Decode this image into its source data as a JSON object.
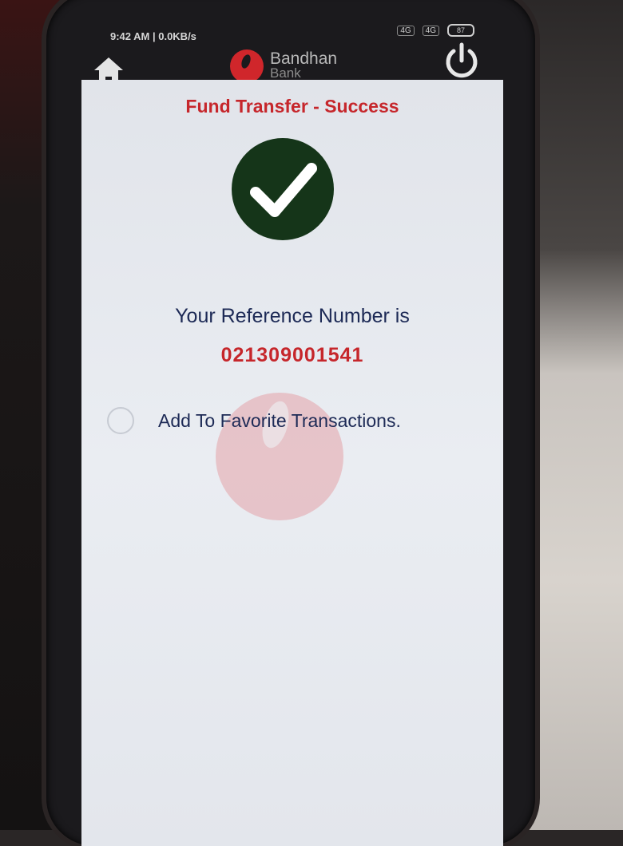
{
  "status_bar": {
    "time": "9:42 AM | 0.0KB/s",
    "sim1_label": "4G",
    "sim2_label": "4G",
    "battery": "87"
  },
  "app_bar": {
    "logo_name": "Bandhan",
    "logo_sub": "Bank",
    "home_icon": "home-icon",
    "power_icon": "power-icon"
  },
  "content": {
    "title": "Fund Transfer - Success",
    "reference_label": "Your Reference Number is",
    "reference_number": "021309001541",
    "favorite_label": "Add To Favorite Transactions."
  },
  "colors": {
    "accent_red": "#c6262b",
    "text_navy": "#1d2a56",
    "success_green": "#153519",
    "screen_bg": "#e6e9ee"
  }
}
